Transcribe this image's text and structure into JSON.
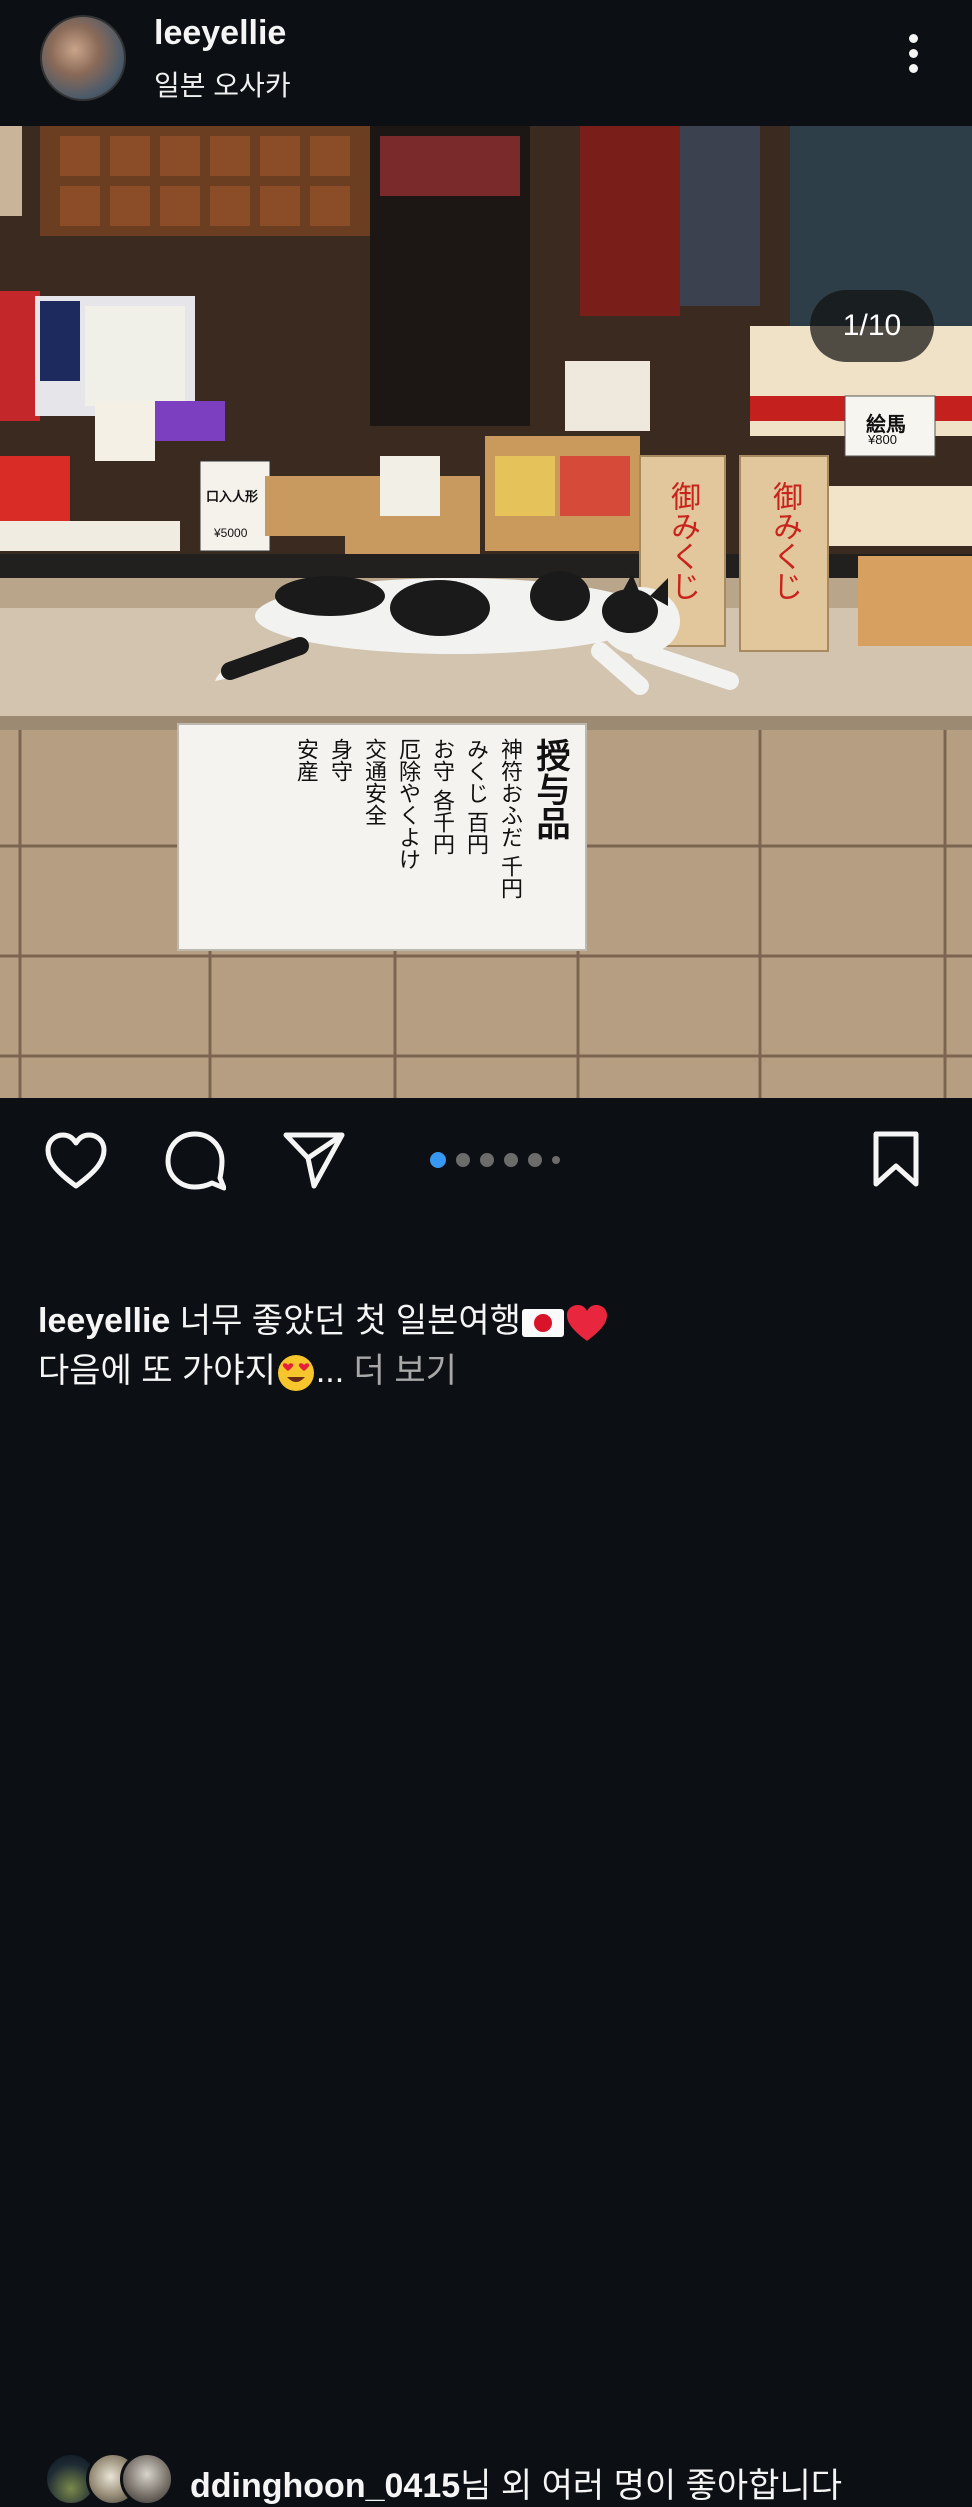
{
  "post": {
    "username": "leeyellie",
    "location": "일본 오사카",
    "image_counter": "1/10",
    "carousel": {
      "total_dots": 6,
      "active_index": 0
    },
    "likes": {
      "user": "ddinghoon_0415",
      "suffix": "님 외 여러 명이 좋아합니다"
    },
    "caption": {
      "username": "leeyellie",
      "line1": "너무 좋았던 첫 일본여행",
      "line2": "다음에 또 가야지",
      "ellipsis": "...",
      "more_label": "더 보기"
    }
  },
  "photo_text": {
    "sign_title": "授与品",
    "sign_col1": "神符おふだ 千円",
    "sign_col2": "みくじ 百円",
    "sign_col3": "お守 各千円",
    "sign_col4": "厄除やくよけ",
    "sign_col5": "交通安全",
    "sign_col6": "身守",
    "sign_col7": "安産",
    "omikuji_label": "御みくじ",
    "ema_label": "絵馬",
    "ema_price": "¥800",
    "doll_label": "口入人形",
    "doll_price": "¥5000"
  },
  "colors": {
    "background": "#0c1014",
    "text": "#f5f5f5",
    "accent": "#3897f0",
    "muted": "#a8a8a8"
  },
  "icons": [
    "more-vertical-icon",
    "heart-icon",
    "comment-icon",
    "share-icon",
    "bookmark-icon",
    "japan-flag-icon",
    "red-heart-icon",
    "heart-eyes-icon"
  ]
}
